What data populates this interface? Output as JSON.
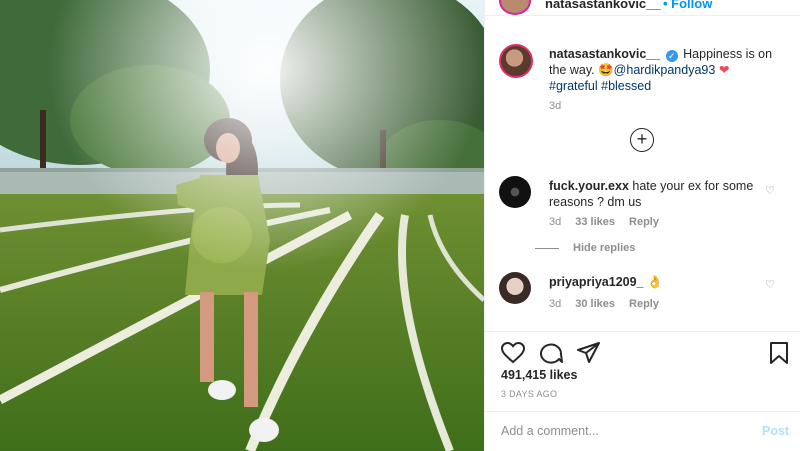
{
  "header": {
    "username": "natasastankovic__",
    "follow_label": "• Follow"
  },
  "caption": {
    "username": "natasastankovic__",
    "verified_mark": "✓",
    "text": " Happiness is on the way. 🤩",
    "mention": "@hardikpandya93",
    "heart": "❤",
    "hashtags": "#grateful #blessed",
    "time": "3d"
  },
  "load_more_icon": "plus-circle-icon",
  "comments": [
    {
      "username": "fuck.your.exx",
      "text": " hate your ex for some reasons ? dm us",
      "time": "3d",
      "likes": "33 likes",
      "reply": "Reply"
    },
    {
      "username": "priyapriya1209_",
      "text": " 👌",
      "time": "3d",
      "likes": "30 likes",
      "reply": "Reply"
    }
  ],
  "hide_replies": "Hide replies",
  "actions": {
    "likes_count": "491,415 likes",
    "posted_ago": "3 DAYS AGO"
  },
  "add_comment": {
    "placeholder": "Add a comment...",
    "post_label": "Post"
  },
  "colors": {
    "link_blue": "#0095f6",
    "hashtag": "#00376b",
    "muted": "#8e8e8e",
    "post_disabled": "#b2dffc"
  }
}
